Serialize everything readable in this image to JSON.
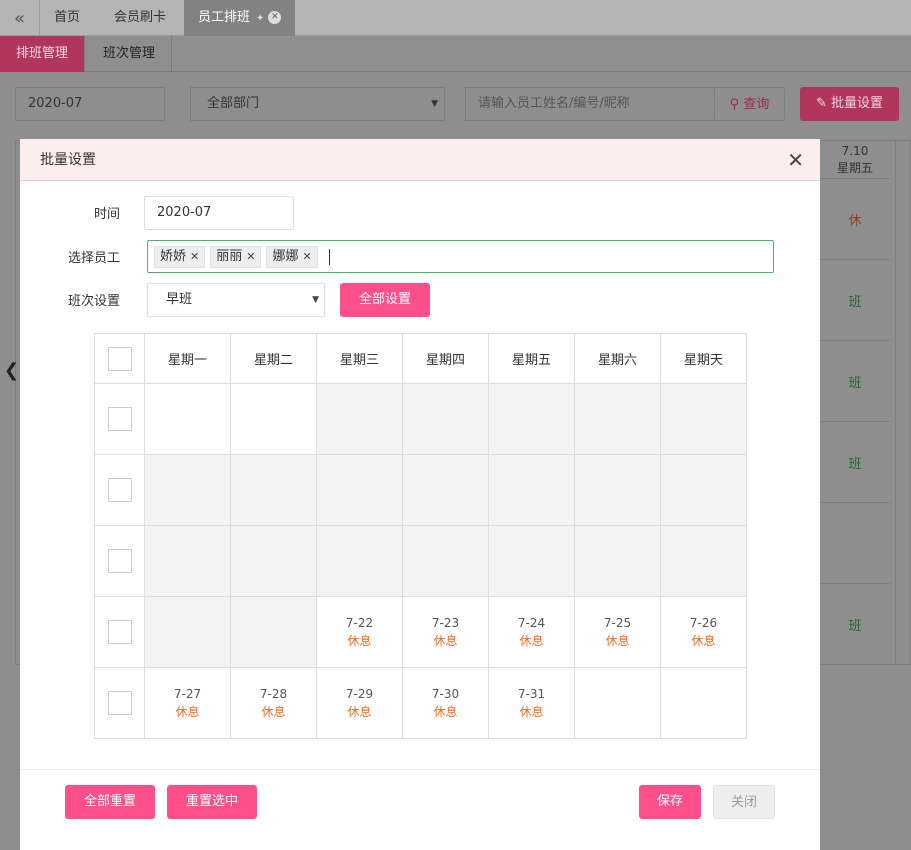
{
  "tabs": {
    "back_icon": "double-chevron-left-icon",
    "items": [
      "首页",
      "会员刷卡",
      "员工排班"
    ]
  },
  "subnav": [
    "排班管理",
    "班次管理"
  ],
  "filters": {
    "month": "2020-07",
    "department": "全部部门",
    "search_placeholder": "请输入员工姓名/编号/昵称",
    "query_label": "查询",
    "batch_label": "批量设置"
  },
  "background_table": {
    "col_date": "7.10",
    "col_weekday": "星期五",
    "cells": [
      "休",
      "班",
      "班",
      "班",
      "",
      "班"
    ]
  },
  "modal": {
    "title": "批量设置",
    "time_label": "时间",
    "time_value": "2020-07",
    "employee_label": "选择员工",
    "employees": [
      "娇娇",
      "丽丽",
      "娜娜"
    ],
    "shift_label": "班次设置",
    "shift_value": "早班",
    "apply_all_label": "全部设置",
    "weekdays": [
      "星期一",
      "星期二",
      "星期三",
      "星期四",
      "星期五",
      "星期六",
      "星期天"
    ],
    "rows": [
      [
        null,
        null,
        null,
        null,
        null,
        null,
        null
      ],
      [
        null,
        null,
        null,
        null,
        null,
        null,
        null
      ],
      [
        null,
        null,
        null,
        null,
        null,
        null,
        null
      ],
      [
        null,
        null,
        {
          "date": "7-22",
          "status": "休息"
        },
        {
          "date": "7-23",
          "status": "休息"
        },
        {
          "date": "7-24",
          "status": "休息"
        },
        {
          "date": "7-25",
          "status": "休息"
        },
        {
          "date": "7-26",
          "status": "休息"
        }
      ],
      [
        {
          "date": "7-27",
          "status": "休息"
        },
        {
          "date": "7-28",
          "status": "休息"
        },
        {
          "date": "7-29",
          "status": "休息"
        },
        {
          "date": "7-30",
          "status": "休息"
        },
        {
          "date": "7-31",
          "status": "休息"
        },
        null,
        null
      ]
    ],
    "reset_all_label": "全部重置",
    "reset_selected_label": "重置选中",
    "save_label": "保存",
    "close_label": "关闭"
  },
  "colors": {
    "accent": "#ff4f8b",
    "rest_text": "#ee6c27",
    "selected_border": "#44b86b"
  }
}
